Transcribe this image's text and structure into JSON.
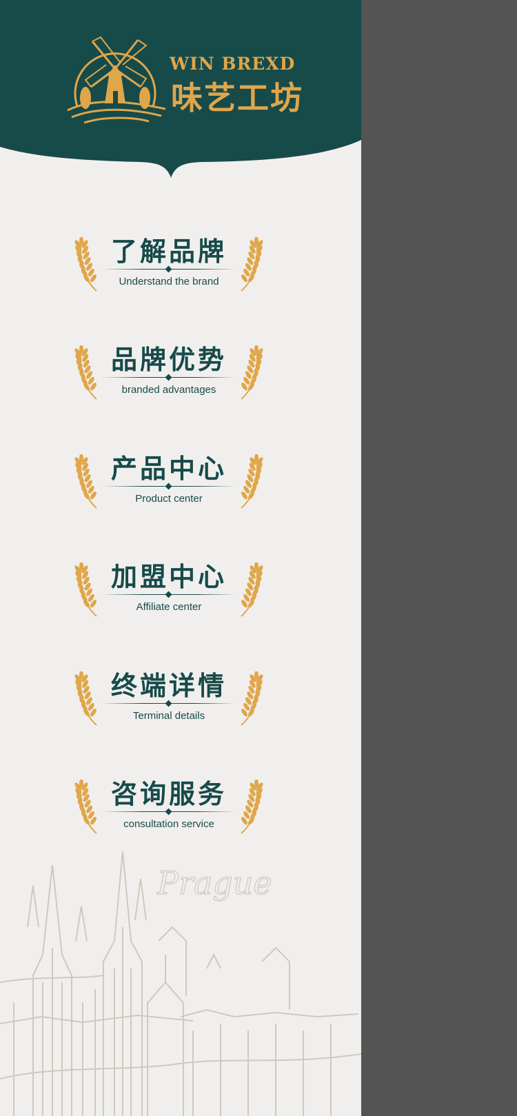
{
  "brand": {
    "name_en": "WIN BREXD",
    "name_cn": "味艺工坊"
  },
  "colors": {
    "header_bg": "#164b4a",
    "gold": "#e0a64a",
    "text_green": "#164b4a",
    "paper": "#f1efed",
    "outside": "#545454",
    "sketch": "#cfc8bd"
  },
  "icons": {
    "logo": "windmill-icon",
    "ornament": "wheat-icon"
  },
  "menu": [
    {
      "cn": "了解品牌",
      "en": "Understand the brand"
    },
    {
      "cn": "品牌优势",
      "en": "branded advantages"
    },
    {
      "cn": "产品中心",
      "en": "Product center"
    },
    {
      "cn": "加盟中心",
      "en": "Affiliate center"
    },
    {
      "cn": "终端详情",
      "en": "Terminal details"
    },
    {
      "cn": "咨询服务",
      "en": "consultation service"
    }
  ],
  "decoration": {
    "signature": "Prague"
  }
}
